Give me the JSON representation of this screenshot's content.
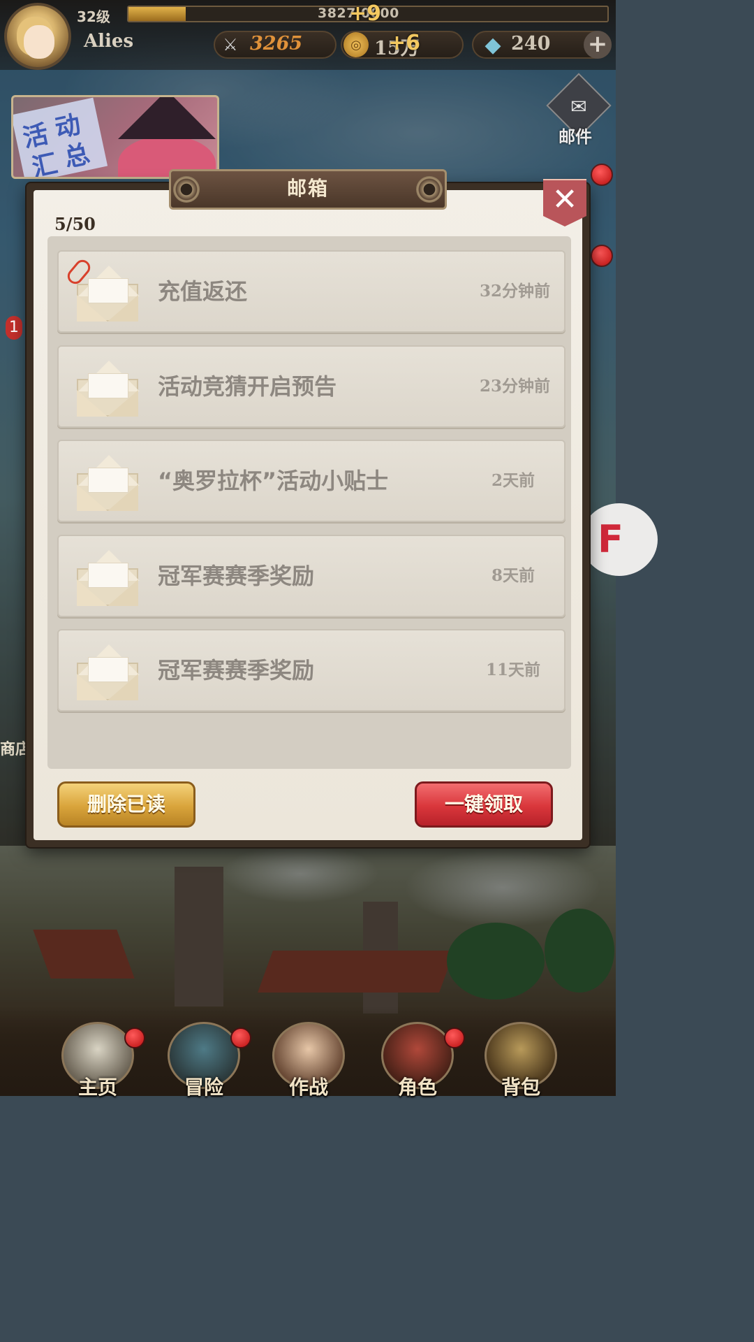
{
  "player": {
    "level": "32级",
    "name": "Alies",
    "xp_text": "3827 0000",
    "xp_fraction": 0.12,
    "xp_float": "+9"
  },
  "resources": {
    "power": "3265",
    "gold": "15万",
    "gold_float": "+6",
    "gems": "240"
  },
  "event_banner": {
    "chars": [
      "活",
      "动",
      "汇",
      "总"
    ]
  },
  "side": {
    "mail_label": "邮件",
    "shop_label": "商店",
    "left_badge": "1",
    "f_button": "F"
  },
  "mailbox": {
    "title": "邮箱",
    "count": "5/50",
    "items": [
      {
        "title": "充值返还",
        "time": "32分钟前",
        "has_attachment": true
      },
      {
        "title": "活动竞猜开启预告",
        "time": "23分钟前",
        "has_attachment": false
      },
      {
        "title": "“奥罗拉杯”活动小贴士",
        "time": "2天前",
        "has_attachment": false
      },
      {
        "title": "冠军赛赛季奖励",
        "time": "8天前",
        "has_attachment": false
      },
      {
        "title": "冠军赛赛季奖励",
        "time": "11天前",
        "has_attachment": false
      }
    ],
    "delete_read_label": "删除已读",
    "claim_all_label": "一键领取"
  },
  "nav": [
    {
      "label": "主页"
    },
    {
      "label": "冒险"
    },
    {
      "label": "作战"
    },
    {
      "label": "角色"
    },
    {
      "label": "背包"
    }
  ],
  "colors": {
    "claim_button": "#d9363b",
    "delete_button": "#d9a43b",
    "title_plate": "#5a4334"
  }
}
